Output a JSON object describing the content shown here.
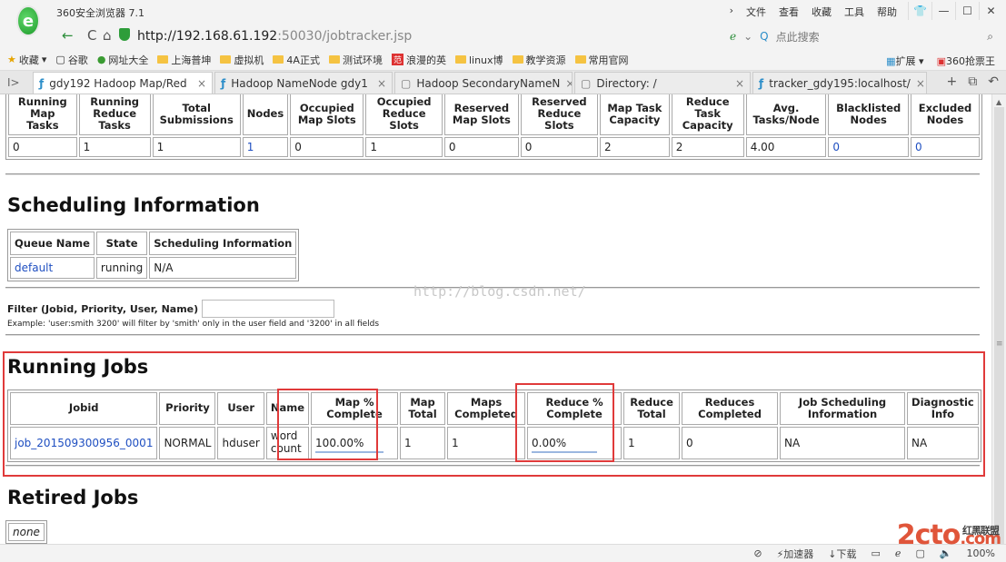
{
  "browser": {
    "title": "360安全浏览器 7.1",
    "menu": [
      "文件",
      "查看",
      "收藏",
      "工具",
      "帮助"
    ],
    "url_host": "http://192.168.61.192",
    "url_rest": ":50030/jobtracker.jsp",
    "search_placeholder": "点此搜索",
    "bookmarks": [
      "收藏",
      "谷歌",
      "网址大全",
      "上海普坤",
      "虚拟机",
      "4A正式",
      "测试环境",
      "浪漫的英",
      "linux博",
      "教学资源",
      "常用官网"
    ],
    "bookmarks_right": [
      "扩展",
      "360抢票王"
    ],
    "tabs": [
      {
        "label": "gdy192 Hadoop Map/Red",
        "active": true
      },
      {
        "label": "Hadoop NameNode gdy1",
        "active": false
      },
      {
        "label": "Hadoop SecondaryNameN",
        "active": false
      },
      {
        "label": "Directory: /",
        "active": false
      },
      {
        "label": "tracker_gdy195:localhost/",
        "active": false
      }
    ],
    "status": [
      "加速器",
      "下载",
      "100%"
    ]
  },
  "summary": {
    "headers": [
      "Running Map Tasks",
      "Running Reduce Tasks",
      "Total Submissions",
      "Nodes",
      "Occupied Map Slots",
      "Occupied Reduce Slots",
      "Reserved Map Slots",
      "Reserved Reduce Slots",
      "Map Task Capacity",
      "Reduce Task Capacity",
      "Avg. Tasks/Node",
      "Blacklisted Nodes",
      "Excluded Nodes"
    ],
    "values": [
      "0",
      "1",
      "1",
      "1",
      "0",
      "1",
      "0",
      "0",
      "2",
      "2",
      "4.00",
      "0",
      "0"
    ]
  },
  "scheduling": {
    "title": "Scheduling Information",
    "headers": [
      "Queue Name",
      "State",
      "Scheduling Information"
    ],
    "row": [
      "default",
      "running",
      "N/A"
    ]
  },
  "filter": {
    "label": "Filter (Jobid, Priority, User, Name)",
    "example": "Example: 'user:smith 3200' will filter by 'smith' only in the user field and '3200' in all fields"
  },
  "watermark": "http://blog.csdn.net/",
  "running": {
    "title": "Running Jobs",
    "headers": [
      "Jobid",
      "Priority",
      "User",
      "Name",
      "Map % Complete",
      "Map Total",
      "Maps Completed",
      "Reduce % Complete",
      "Reduce Total",
      "Reduces Completed",
      "Job Scheduling Information",
      "Diagnostic Info"
    ],
    "row": {
      "jobid": "job_201509300956_0001",
      "priority": "NORMAL",
      "user": "hduser",
      "name": "word count",
      "map_pct": "100.00%",
      "map_total": "1",
      "maps_completed": "1",
      "reduce_pct": "0.00%",
      "reduce_total": "1",
      "reduces_completed": "0",
      "sched_info": "NA",
      "diag": "NA"
    }
  },
  "retired": {
    "title": "Retired Jobs",
    "value": "none"
  },
  "logo": {
    "main": "2cto",
    "suffix": ".com",
    "tag": "红黑联盟"
  }
}
